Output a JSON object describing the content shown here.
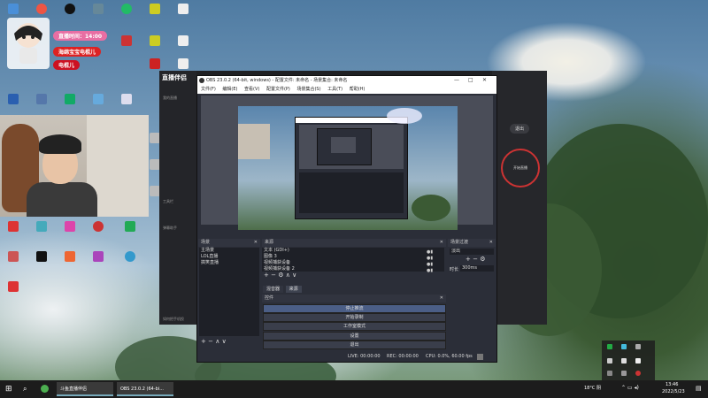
{
  "overlay": {
    "live_time": "直播时间：14:00",
    "badge1": "海绵宝宝电棍儿",
    "badge2": "电棍儿"
  },
  "desktop_icons": {
    "col1": [
      "",
      "",
      "",
      "",
      "",
      "",
      ""
    ],
    "col2": [
      "",
      "",
      "",
      "",
      "",
      ""
    ],
    "col3": [
      "",
      "",
      "",
      "",
      ""
    ],
    "col4": [
      "",
      "",
      "",
      ""
    ],
    "row_bottom": [
      "",
      "",
      "",
      "",
      "",
      "",
      ""
    ]
  },
  "live_app": {
    "title": "直播伴侣",
    "side_items": [
      "我的直播",
      "",
      "",
      "",
      "工具栏",
      "弹幕助手",
      "",
      "",
      "",
      "如何把手机投"
    ],
    "exit_label": "退出",
    "start_label": "开始直播"
  },
  "obs": {
    "title": "OBS 23.0.2 (64-bit, windows) - 配置文件: 未命名 - 场景集合: 未命名",
    "menu": [
      "文件(F)",
      "编辑(E)",
      "查看(V)",
      "配置文件(P)",
      "场景集合(S)",
      "工具(T)",
      "帮助(H)"
    ],
    "scenes_header": "场景",
    "scenes": [
      "主场景",
      "LOL直播",
      "搞笑直播"
    ],
    "sources_header": "来源",
    "sources": [
      "文本 (GDI+)",
      "图像 3",
      "视频捕获设备",
      "视频捕获设备 2"
    ],
    "mixer_header": "场景过渡",
    "transition_value": "淡出",
    "duration_label": "时长",
    "duration_value": "300ms",
    "tabs": [
      "混音器",
      "来源"
    ],
    "controls_header": "控件",
    "controls": [
      "停止推流",
      "开始录制",
      "工作室模式",
      "设置",
      "退出"
    ],
    "status": {
      "live": "LIVE: 00:00:00",
      "rec": "REC: 00:00:00",
      "cpu": "CPU: 0.0%, 60.00 fps"
    }
  },
  "taskbar": {
    "apps": [
      "斗鱼直播伴侣",
      "OBS 23.0.2 (64-bi..."
    ],
    "weather": "18°C 阴",
    "time": "13:46",
    "date": "2022/5/23"
  },
  "colors": {
    "obs_bg": "#2b2e38",
    "obs_accent": "#4b5e86",
    "taskbar": "#1c1c1c"
  }
}
